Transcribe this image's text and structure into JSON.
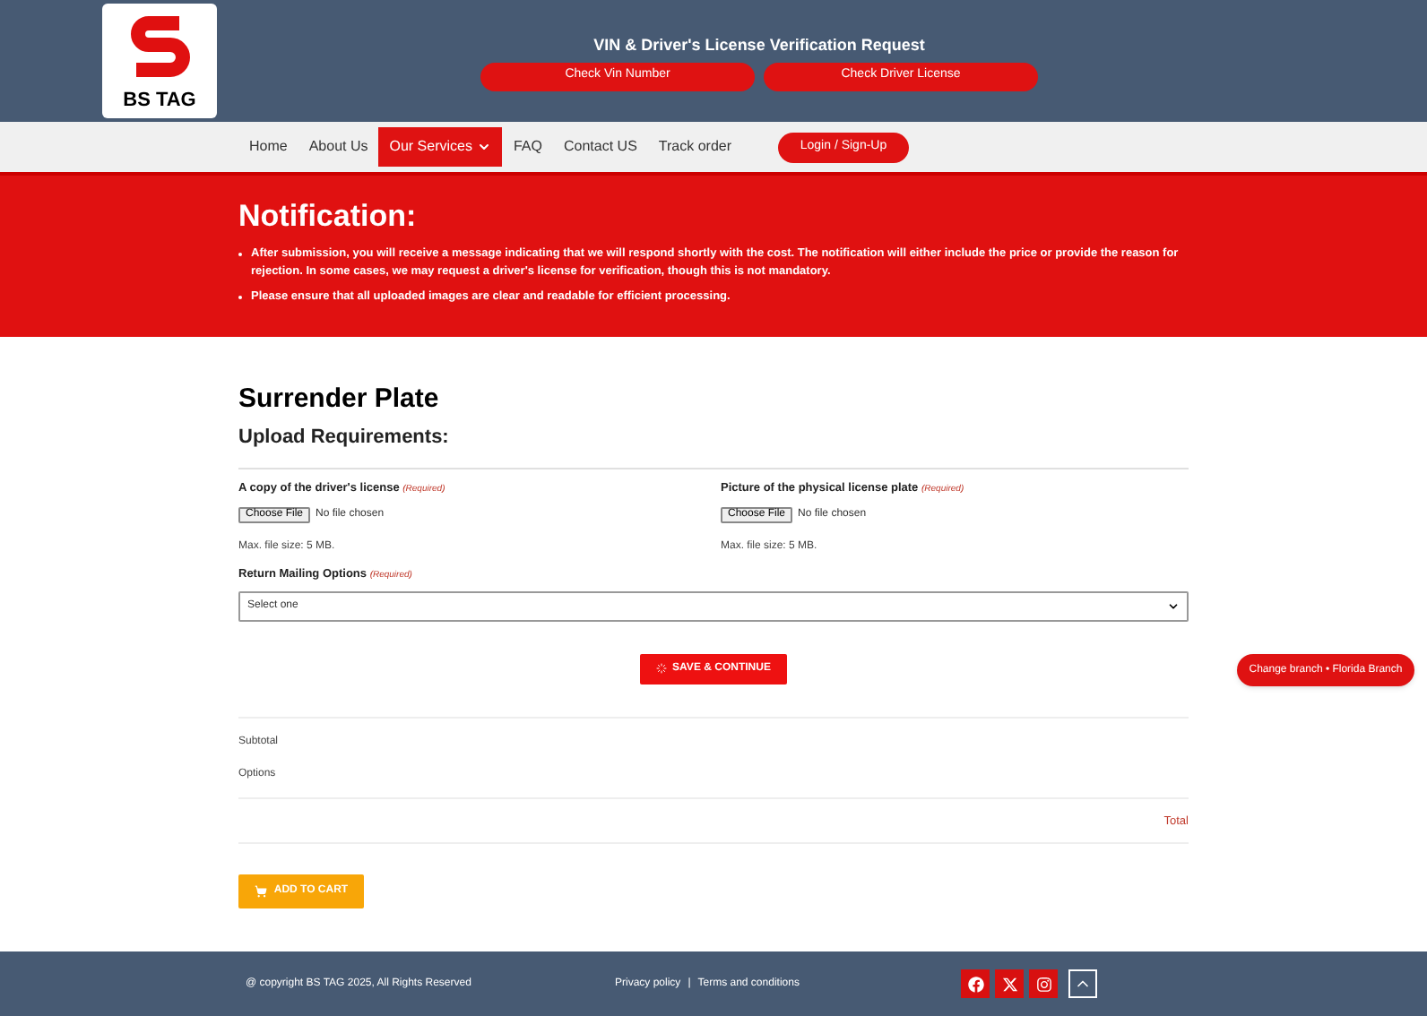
{
  "logo": {
    "text": "BS TAG"
  },
  "header": {
    "title": "VIN & Driver's License Verification Request",
    "buttons": [
      "Check Vin Number",
      "Check Driver License"
    ]
  },
  "nav": {
    "items": [
      {
        "label": "Home",
        "selected": false,
        "dropdown": false
      },
      {
        "label": "About Us",
        "selected": false,
        "dropdown": false
      },
      {
        "label": "Our Services",
        "selected": true,
        "dropdown": true
      },
      {
        "label": "FAQ",
        "selected": false,
        "dropdown": false
      },
      {
        "label": "Contact US",
        "selected": false,
        "dropdown": false
      },
      {
        "label": "Track order",
        "selected": false,
        "dropdown": false
      }
    ],
    "login": "Login / Sign-Up"
  },
  "notification": {
    "title": "Notification:",
    "bullets": [
      "After submission, you will receive a message indicating that we will respond shortly with the cost. The notification will either include the price or provide the reason for rejection. In some cases, we may request a driver's license for verification, though this is not mandatory.",
      "Please ensure that all uploaded images are clear and readable for efficient processing."
    ]
  },
  "form": {
    "title": "Surrender Plate",
    "subtitle": "Upload Requirements:",
    "uploads": [
      {
        "label": "A copy of the driver's license",
        "required": "(Required)",
        "button": "Choose File",
        "status": "No file chosen",
        "note": "Max. file size: 5 MB."
      },
      {
        "label": "Picture of the physical license plate",
        "required": "(Required)",
        "button": "Choose File",
        "status": "No file chosen",
        "note": "Max. file size: 5 MB."
      }
    ],
    "mailing": {
      "label": "Return Mailing Options",
      "required": "(Required)",
      "value": "Select one"
    },
    "save": "SAVE & CONTINUE"
  },
  "branch_button": "Change branch • Florida Branch",
  "summary": {
    "subtotal": "Subtotal",
    "options": "Options",
    "total": "Total"
  },
  "add_to_cart": "ADD TO CART",
  "footer": {
    "copyright": "@ copyright BS TAG 2025, All Rights Reserved",
    "links": [
      "Privacy policy",
      "Terms and conditions"
    ],
    "separator": "|"
  }
}
